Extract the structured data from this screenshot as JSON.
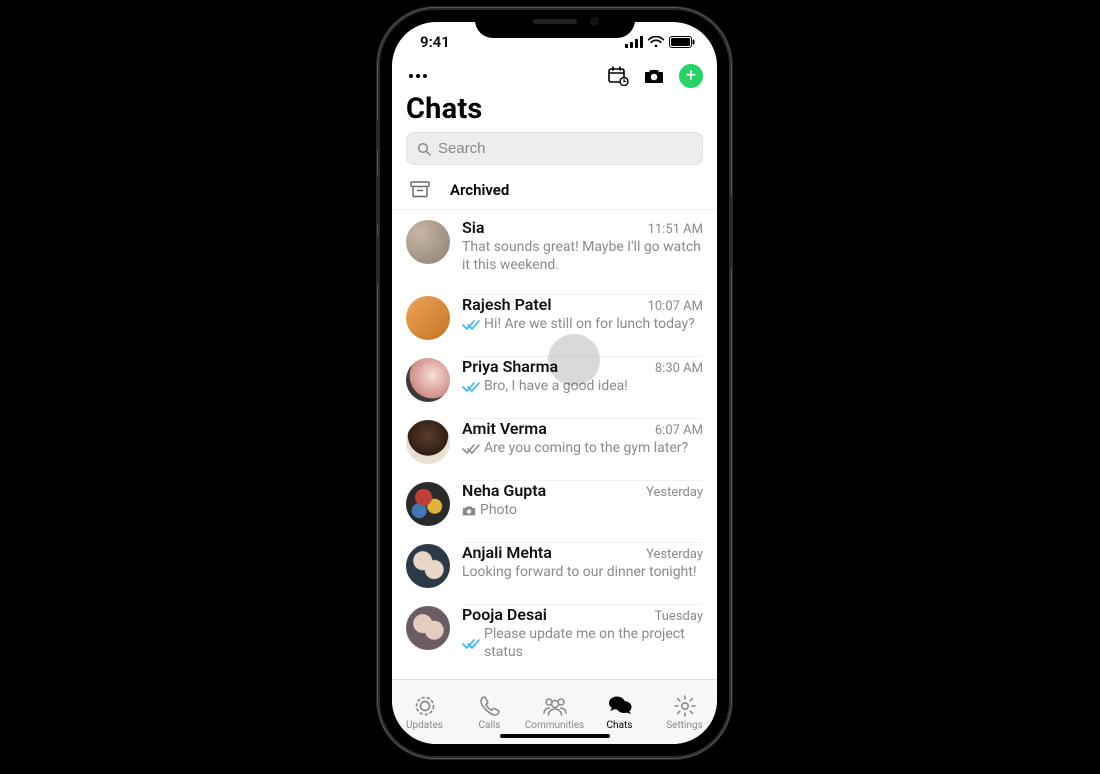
{
  "status": {
    "time": "9:41"
  },
  "header": {
    "title": "Chats"
  },
  "search": {
    "placeholder": "Search"
  },
  "archived": {
    "label": "Archived"
  },
  "plus": {
    "glyph": "+"
  },
  "chats": [
    {
      "name": "Sia",
      "time": "11:51 AM",
      "msg": "That sounds great! Maybe I'll go watch it this weekend.",
      "ticks": "none",
      "photo": false
    },
    {
      "name": "Rajesh Patel",
      "time": "10:07 AM",
      "msg": "Hi! Are we still on for lunch today?",
      "ticks": "read",
      "photo": false
    },
    {
      "name": "Priya Sharma",
      "time": "8:30 AM",
      "msg": "Bro, I have a good idea!",
      "ticks": "read",
      "photo": false
    },
    {
      "name": "Amit Verma",
      "time": "6:07 AM",
      "msg": "Are you coming to the gym later?",
      "ticks": "delivered",
      "photo": false
    },
    {
      "name": "Neha Gupta",
      "time": "Yesterday",
      "msg": "Photo",
      "ticks": "none",
      "photo": true
    },
    {
      "name": "Anjali Mehta",
      "time": "Yesterday",
      "msg": "Looking forward to our dinner tonight!",
      "ticks": "none",
      "photo": false
    },
    {
      "name": "Pooja Desai",
      "time": "Tuesday",
      "msg": "Please update me on the project status",
      "ticks": "read",
      "photo": false
    }
  ],
  "tabs": {
    "updates": "Updates",
    "calls": "Calls",
    "communities": "Communities",
    "chats": "Chats",
    "settings": "Settings"
  },
  "colors": {
    "accent": "#25d366",
    "read_tick": "#34b7f1",
    "delivered_tick": "#8a8a8a"
  }
}
